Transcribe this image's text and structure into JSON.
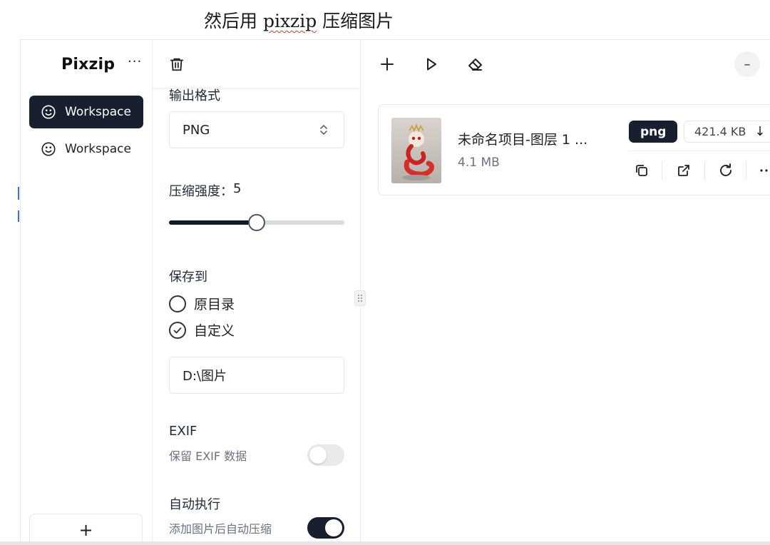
{
  "caption": {
    "before": "然后用 ",
    "app_word": "pixzip",
    "after": " 压缩图片"
  },
  "sidebar": {
    "title": "Pixzip",
    "more_label": "···",
    "workspaces": [
      {
        "label": "Workspace",
        "active": true
      },
      {
        "label": "Workspace",
        "active": false
      }
    ],
    "add_label": "+"
  },
  "settings": {
    "output_format_label": "输出格式",
    "output_format_value": "PNG",
    "strength_label": "压缩强度：",
    "strength_value": "5",
    "strength_fraction": 0.5,
    "save_to_label": "保存到",
    "save_options": [
      {
        "label": "原目录",
        "selected": false
      },
      {
        "label": "自定义",
        "selected": true
      }
    ],
    "custom_path": "D:\\图片",
    "exif": {
      "title": "EXIF",
      "desc": "保留 EXIF 数据",
      "enabled": false
    },
    "auto_run": {
      "title": "自动执行",
      "desc": "添加图片后自动压缩",
      "enabled": true
    }
  },
  "toolbar": {
    "add_icon": "plus-icon",
    "run_icon": "play-icon",
    "clear_icon": "eraser-icon",
    "minimize_label": "–"
  },
  "file": {
    "name": "未命名项目-图层 1 ...",
    "original_size": "4.1 MB",
    "format_badge": "png",
    "compressed_size": "421.4 KB",
    "download_arrow": "↓",
    "actions": [
      "copy-icon",
      "open-external-icon",
      "refresh-icon",
      "more-icon"
    ]
  },
  "colors": {
    "accent_dark": "#18202f",
    "muted_text": "#6b7280",
    "border": "#e4e6ea"
  }
}
